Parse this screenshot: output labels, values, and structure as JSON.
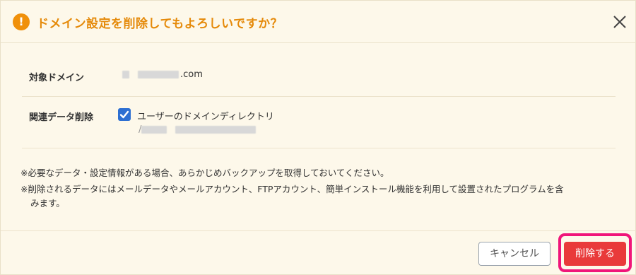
{
  "dialog": {
    "title": "ドメイン設定を削除してもよろしいですか？",
    "warning_icon": "exclamation-circle-icon",
    "close_icon": "close-icon",
    "accent_color": "#e58a0a"
  },
  "rows": {
    "domain": {
      "label": "対象ドメイン",
      "value_suffix": ".com"
    },
    "related_delete": {
      "label": "関連データ削除",
      "checkbox_checked": true,
      "checkbox_label": "ユーザーのドメインディレクトリ",
      "path_prefix": "/"
    }
  },
  "notes": {
    "line1": "※必要なデータ・設定情報がある場合、あらかじめバックアップを取得しておいてください。",
    "line2": "※削除されるデータにはメールデータやメールアカウント、FTPアカウント、簡単インストール機能を利用して設置されたプログラムを含",
    "line3": "みます。"
  },
  "footer": {
    "cancel_label": "キャンセル",
    "delete_label": "削除する",
    "delete_color": "#e93a3a",
    "highlight_color": "#f0157a"
  }
}
